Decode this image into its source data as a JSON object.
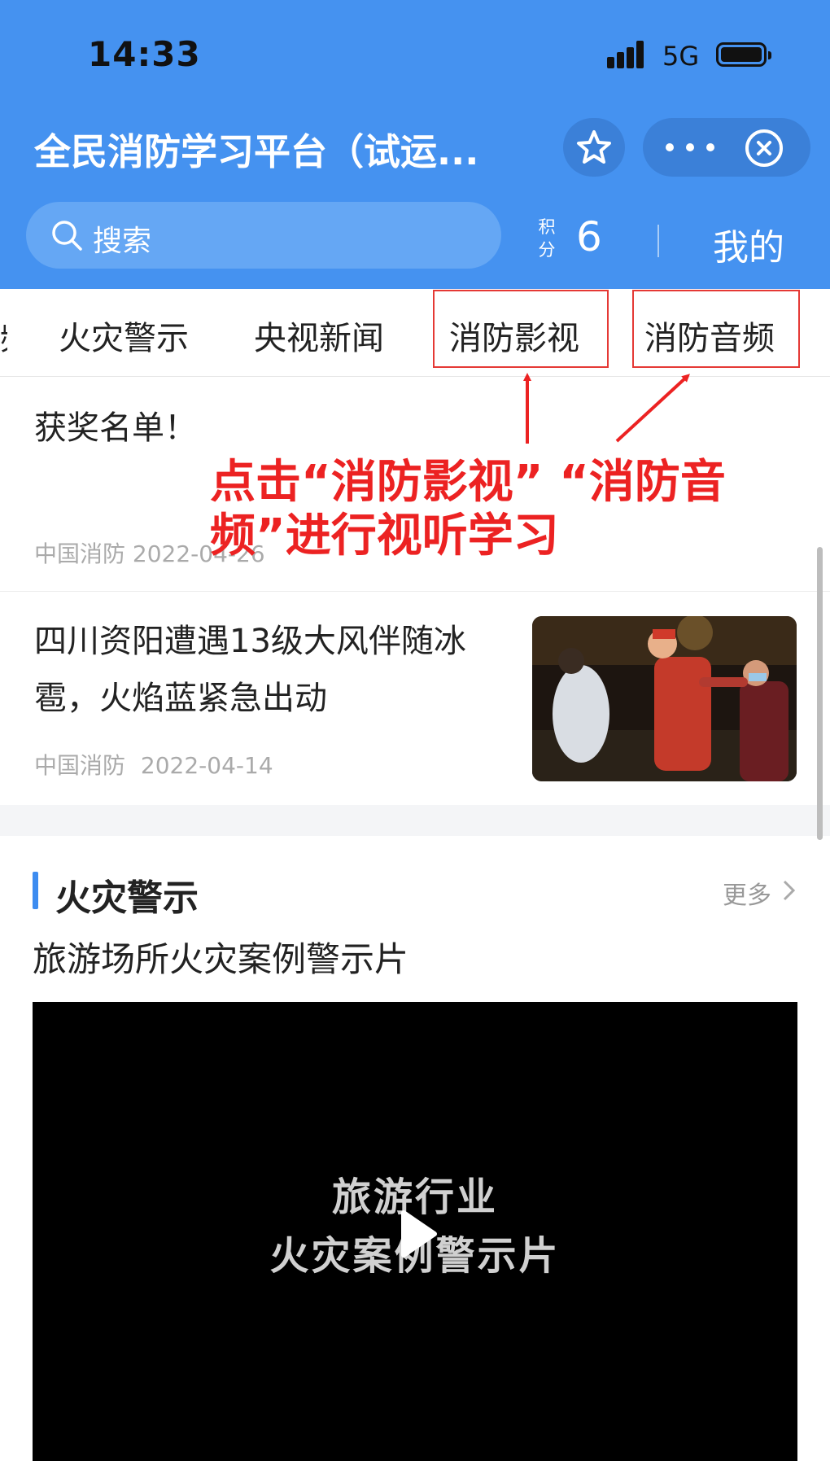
{
  "status_bar": {
    "time": "14:33",
    "network": "5G"
  },
  "header": {
    "title": "全民消防学习平台（试运...",
    "search_placeholder": "搜索",
    "points_label": "积分",
    "points_value": "6",
    "mine_label": "我的"
  },
  "tabs": [
    {
      "label": "火灾警示"
    },
    {
      "label": "央视新闻"
    },
    {
      "label": "消防影视"
    },
    {
      "label": "消防音频"
    }
  ],
  "news": [
    {
      "title": "获奖名单！",
      "meta": "中国消防 2022-04-26"
    },
    {
      "title": "四川资阳遭遇13级大风伴随冰雹，火焰蓝紧急出动",
      "source": "中国消防",
      "date": "2022-04-14"
    }
  ],
  "section": {
    "title": "火灾警示",
    "more_label": "更多",
    "item_title": "旅游场所火灾案例警示片",
    "video_line1": "旅游行业",
    "video_line2": "火灾案例警示片"
  },
  "annotation": {
    "text": "点击“消防影视” “消防音频”进行视听学习",
    "color": "#ec2222"
  },
  "colors": {
    "brand": "#4592f0",
    "accent": "#3d8cf0"
  }
}
